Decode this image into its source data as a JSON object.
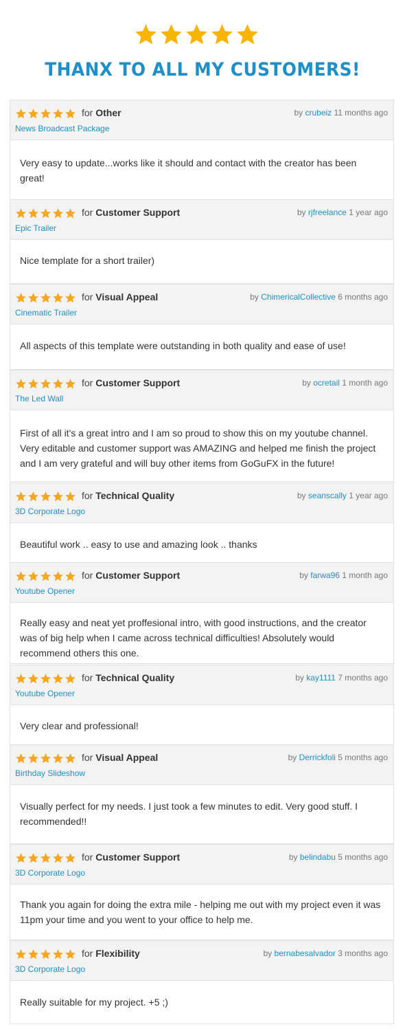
{
  "header": {
    "title": "THANX TO ALL  MY CUSTOMERS!",
    "star_icon": "star-icon",
    "star_color": "#f7b500",
    "title_color": "#1e8fc7"
  },
  "labels": {
    "for": "for",
    "by": "by"
  },
  "reviews": [
    {
      "rating": 5,
      "category": "Other",
      "item": "News Broadcast Package",
      "user": "crubeiz",
      "time": "11 months ago",
      "text": "Very easy to update...works like it should and contact with the creator has been great!"
    },
    {
      "rating": 5,
      "category": "Customer Support",
      "item": "Epic Trailer",
      "user": "rjfreelance",
      "time": "1 year ago",
      "text": "Nice template for a short trailer)"
    },
    {
      "rating": 5,
      "category": "Visual Appeal",
      "item": "Cinematic Trailer",
      "user": "ChimericalCollective",
      "time": "6 months ago",
      "text": "All aspects of this template were outstanding in both quality and ease of use!"
    },
    {
      "rating": 5,
      "category": "Customer Support",
      "item": "The Led Wall",
      "user": "ocretail",
      "time": "1 month ago",
      "text": "First of all it's a great intro and I am so proud to show this on my youtube channel. Very editable and customer support was AMAZING and helped me finish the project and I am very grateful and will buy other items from GoGuFX in the future!"
    },
    {
      "rating": 5,
      "category": "Technical Quality",
      "item": "3D Corporate Logo",
      "user": "seanscally",
      "time": "1 year ago",
      "text": "Beautiful work .. easy to use and amazing look .. thanks"
    },
    {
      "rating": 5,
      "category": "Customer Support",
      "item": "Youtube Opener",
      "user": "farwa96",
      "time": "1 month ago",
      "text": "Really easy and neat yet proffesional intro, with good instructions, and the creator was of big help when I came across technical difficulties! Absolutely would recommend others this one."
    },
    {
      "rating": 5,
      "category": "Technical Quality",
      "item": "Youtube Opener",
      "user": "kay1111",
      "time": "7 months ago",
      "text": "Very clear and professional!"
    },
    {
      "rating": 5,
      "category": "Visual Appeal",
      "item": "Birthday Slideshow",
      "user": "Derrickfoli",
      "time": "5 months ago",
      "text": "Visually perfect for my needs. I just took a few minutes to edit. Very good stuff. I recommended!!"
    },
    {
      "rating": 5,
      "category": "Customer Support",
      "item": "3D Corporate Logo",
      "user": "belindabu",
      "time": "5 months ago",
      "text": "Thank you again for doing the extra mile - helping me out with my project even it was 11pm your time and you went to your office to help me."
    },
    {
      "rating": 5,
      "category": "Flexibility",
      "item": "3D Corporate Logo",
      "user": "bernabesalvador",
      "time": "3 months ago",
      "text": "Really suitable for my project. +5 ;)"
    }
  ]
}
